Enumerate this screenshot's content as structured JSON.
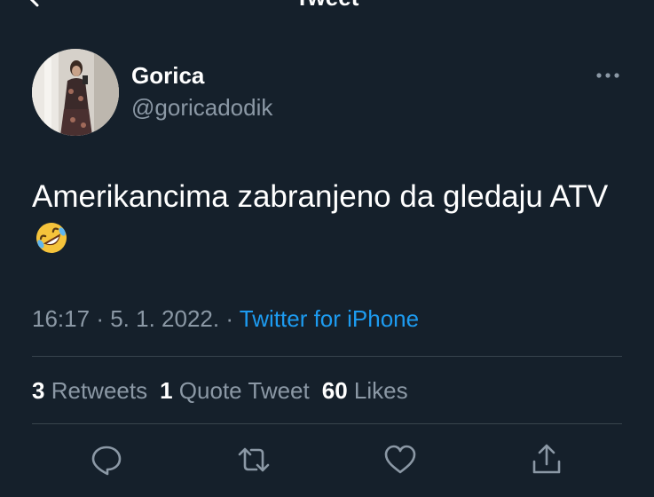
{
  "topbar": {
    "title": "Tweet",
    "back_icon": "back-arrow-icon"
  },
  "author": {
    "name": "Gorica",
    "handle": "@goricadodik",
    "more_icon": "more-dots-icon"
  },
  "tweet": {
    "text": "Amerikancima zabranjeno da gledaju ATV",
    "emoji": "rolling-on-floor-laughing-emoji"
  },
  "meta": {
    "time": "16:17",
    "date": "5. 1. 2022.",
    "sep": "·",
    "source": "Twitter for iPhone"
  },
  "stats": {
    "retweets_count": "3",
    "retweets_label": "Retweets",
    "quotes_count": "1",
    "quotes_label": "Quote Tweet",
    "likes_count": "60",
    "likes_label": "Likes"
  },
  "actions": [
    "reply-icon",
    "retweet-icon",
    "like-icon",
    "share-icon"
  ],
  "colors": {
    "background": "#15202b",
    "secondary_text": "#8b98a5",
    "link": "#1d9bf0",
    "divider": "#38444d"
  }
}
